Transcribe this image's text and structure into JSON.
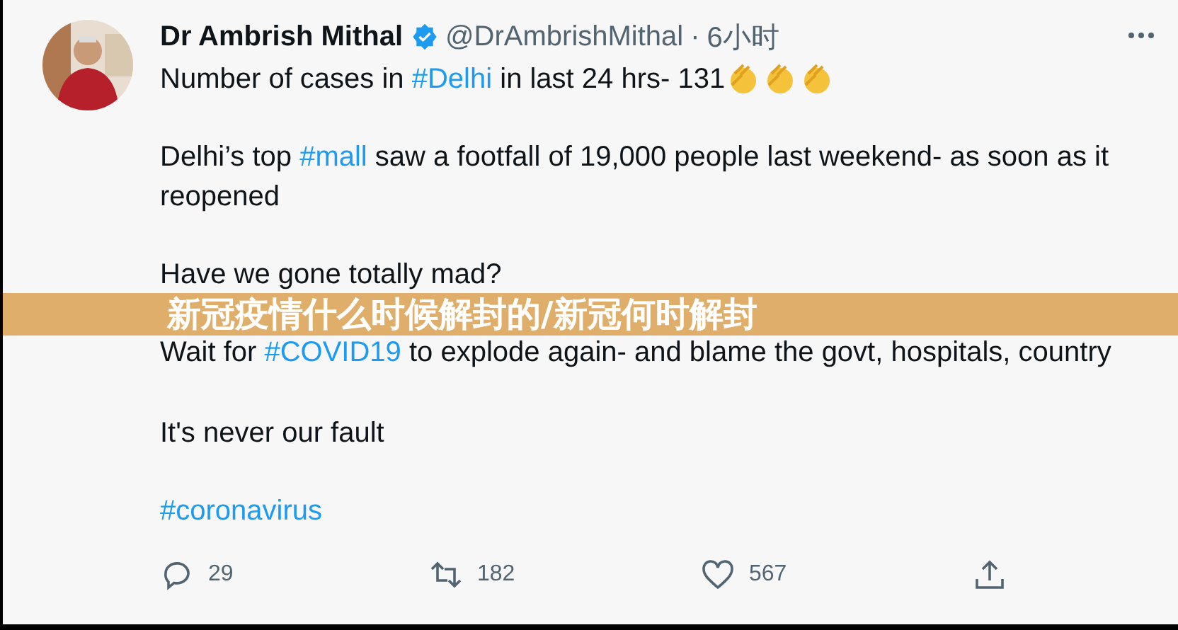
{
  "tweet": {
    "author": {
      "name": "Dr Ambrish Mithal",
      "handle": "@DrAmbrishMithal",
      "separator": "·",
      "time": "6小时"
    },
    "paragraphs": [
      [
        {
          "kind": "text",
          "text": "Number of cases in "
        },
        {
          "kind": "hashtag",
          "text": "#Delhi"
        },
        {
          "kind": "text",
          "text": " in last 24 hrs- 131"
        },
        {
          "kind": "clap"
        },
        {
          "kind": "clap"
        },
        {
          "kind": "clap"
        }
      ],
      [
        {
          "kind": "text",
          "text": "Delhi’s top "
        },
        {
          "kind": "hashtag",
          "text": "#mall"
        },
        {
          "kind": "text",
          "text": " saw a footfall of 19,000 people last weekend- as soon as it reopened"
        }
      ],
      [
        {
          "kind": "text",
          "text": "Have we gone totally mad?"
        }
      ],
      [
        {
          "kind": "text",
          "text": "Wait for "
        },
        {
          "kind": "hashtag",
          "text": "#COVID19"
        },
        {
          "kind": "text",
          "text": " to explode again- and blame the govt, hospitals, country"
        }
      ],
      [
        {
          "kind": "text",
          "text": "It's never our fault"
        }
      ],
      [
        {
          "kind": "hashtag",
          "text": "#coronavirus"
        }
      ]
    ],
    "actions": [
      {
        "kind": "reply",
        "count": "29"
      },
      {
        "kind": "retweet",
        "count": "182"
      },
      {
        "kind": "like",
        "count": "567"
      },
      {
        "kind": "share"
      }
    ]
  },
  "banner": {
    "title": "新冠疫情什么时候解封的/新冠何时解封"
  }
}
